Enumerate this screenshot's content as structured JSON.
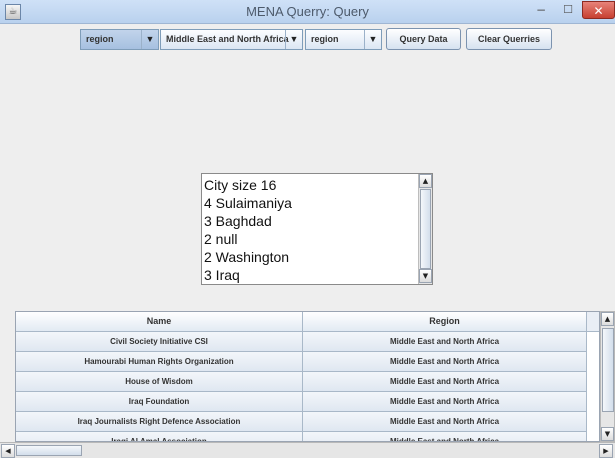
{
  "window": {
    "title": "MENA Querry: Query",
    "app_icon": "java-window-icon",
    "min_label": "−",
    "max_label": "☐",
    "close_label": "✕"
  },
  "toolbar": {
    "combo1": {
      "value": "region",
      "arrow": "▼"
    },
    "combo2": {
      "value": "Middle East and North Africa",
      "arrow": "▼"
    },
    "combo3": {
      "value": "region",
      "arrow": "▼"
    },
    "query_label": "Query Data",
    "clear_label": "Clear Querries"
  },
  "results": {
    "lines": [
      "City size 16",
      "4 Sulaimaniya",
      "3 Baghdad",
      "2 null",
      "2 Washington",
      "3 Iraq"
    ],
    "up_arrow": "▲",
    "down_arrow": "▼"
  },
  "table": {
    "columns": [
      "Name",
      "Region"
    ],
    "rows": [
      {
        "name": "Civil Society Initiative CSI",
        "region": "Middle East and North Africa"
      },
      {
        "name": "Hamourabi Human Rights Organization",
        "region": "Middle East and North Africa"
      },
      {
        "name": "House of Wisdom",
        "region": "Middle East and North Africa"
      },
      {
        "name": "Iraq Foundation",
        "region": "Middle East and North Africa"
      },
      {
        "name": "Iraq Journalists Right Defence Association",
        "region": "Middle East and North Africa"
      },
      {
        "name": "Iraqi Al Amal Association",
        "region": "Middle East and North Africa"
      }
    ]
  },
  "scroll": {
    "up": "▲",
    "down": "▼",
    "left": "◀",
    "right": "▶"
  }
}
